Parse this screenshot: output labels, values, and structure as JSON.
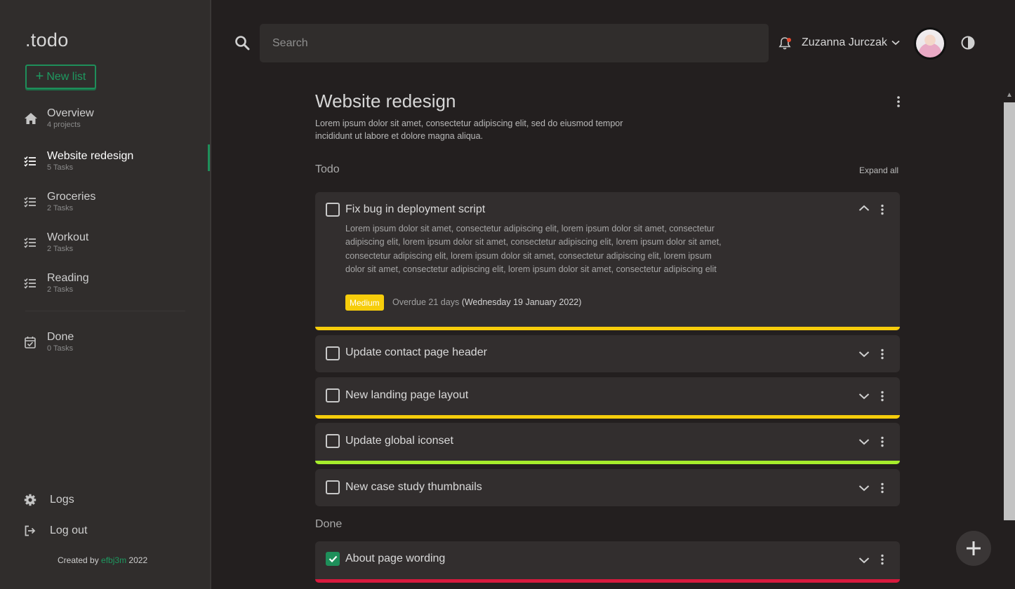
{
  "app": {
    "logo": ".todo",
    "new_list_label": "New list"
  },
  "sidebar": {
    "items": [
      {
        "label": "Overview",
        "sub": "4 projects",
        "icon": "home-icon"
      },
      {
        "label": "Website redesign",
        "sub": "5 Tasks",
        "icon": "checklist-icon",
        "active": true
      },
      {
        "label": "Groceries",
        "sub": "2 Tasks",
        "icon": "checklist-icon"
      },
      {
        "label": "Workout",
        "sub": "2 Tasks",
        "icon": "checklist-icon"
      },
      {
        "label": "Reading",
        "sub": "2 Tasks",
        "icon": "checklist-icon"
      }
    ],
    "done": {
      "label": "Done",
      "sub": "0 Tasks",
      "icon": "calendar-check-icon"
    },
    "footer": {
      "logs": "Logs",
      "logout": "Log out"
    },
    "credit": {
      "prefix": "Created by",
      "author": "efbj3m",
      "year": "2022"
    }
  },
  "header": {
    "search_placeholder": "Search",
    "user_name": "Zuzanna Jurczak"
  },
  "main": {
    "title": "Website redesign",
    "description": "Lorem ipsum dolor sit amet, consectetur adipiscing elit, sed do eiusmod tempor incididunt ut labore et dolore magna aliqua.",
    "todo_heading": "Todo",
    "expand_all": "Expand all",
    "done_heading": "Done",
    "tasks": [
      {
        "title": "Fix bug in deployment script",
        "expanded": true,
        "description": "Lorem ipsum dolor sit amet, consectetur adipiscing elit, lorem ipsum dolor sit amet, consectetur adipiscing elit, lorem ipsum dolor sit amet, consectetur adipiscing elit, lorem ipsum dolor sit amet, consectetur adipiscing elit, lorem ipsum dolor sit amet, consectetur adipiscing elit, lorem ipsum dolor sit amet, consectetur adipiscing elit, lorem ipsum dolor sit amet, consectetur adipiscing elit",
        "priority": "Medium",
        "due_status": "Overdue 21 days",
        "due_date": "(Wednesday 19 January 2022)",
        "priority_color": "#f6cd0b"
      },
      {
        "title": "Update contact page header",
        "priority_color": ""
      },
      {
        "title": "New landing page layout",
        "priority_color": "#f6cd0b"
      },
      {
        "title": "Update global iconset",
        "priority_color": "#a6ec2c"
      },
      {
        "title": "New case study thumbnails",
        "priority_color": ""
      }
    ],
    "done_tasks": [
      {
        "title": "About page wording",
        "checked": true,
        "priority_color": "#d8193d"
      }
    ]
  },
  "colors": {
    "accent": "#1e8f5a",
    "background": "#231f1f",
    "sidebar": "#302d2c",
    "card": "#322e2e"
  }
}
